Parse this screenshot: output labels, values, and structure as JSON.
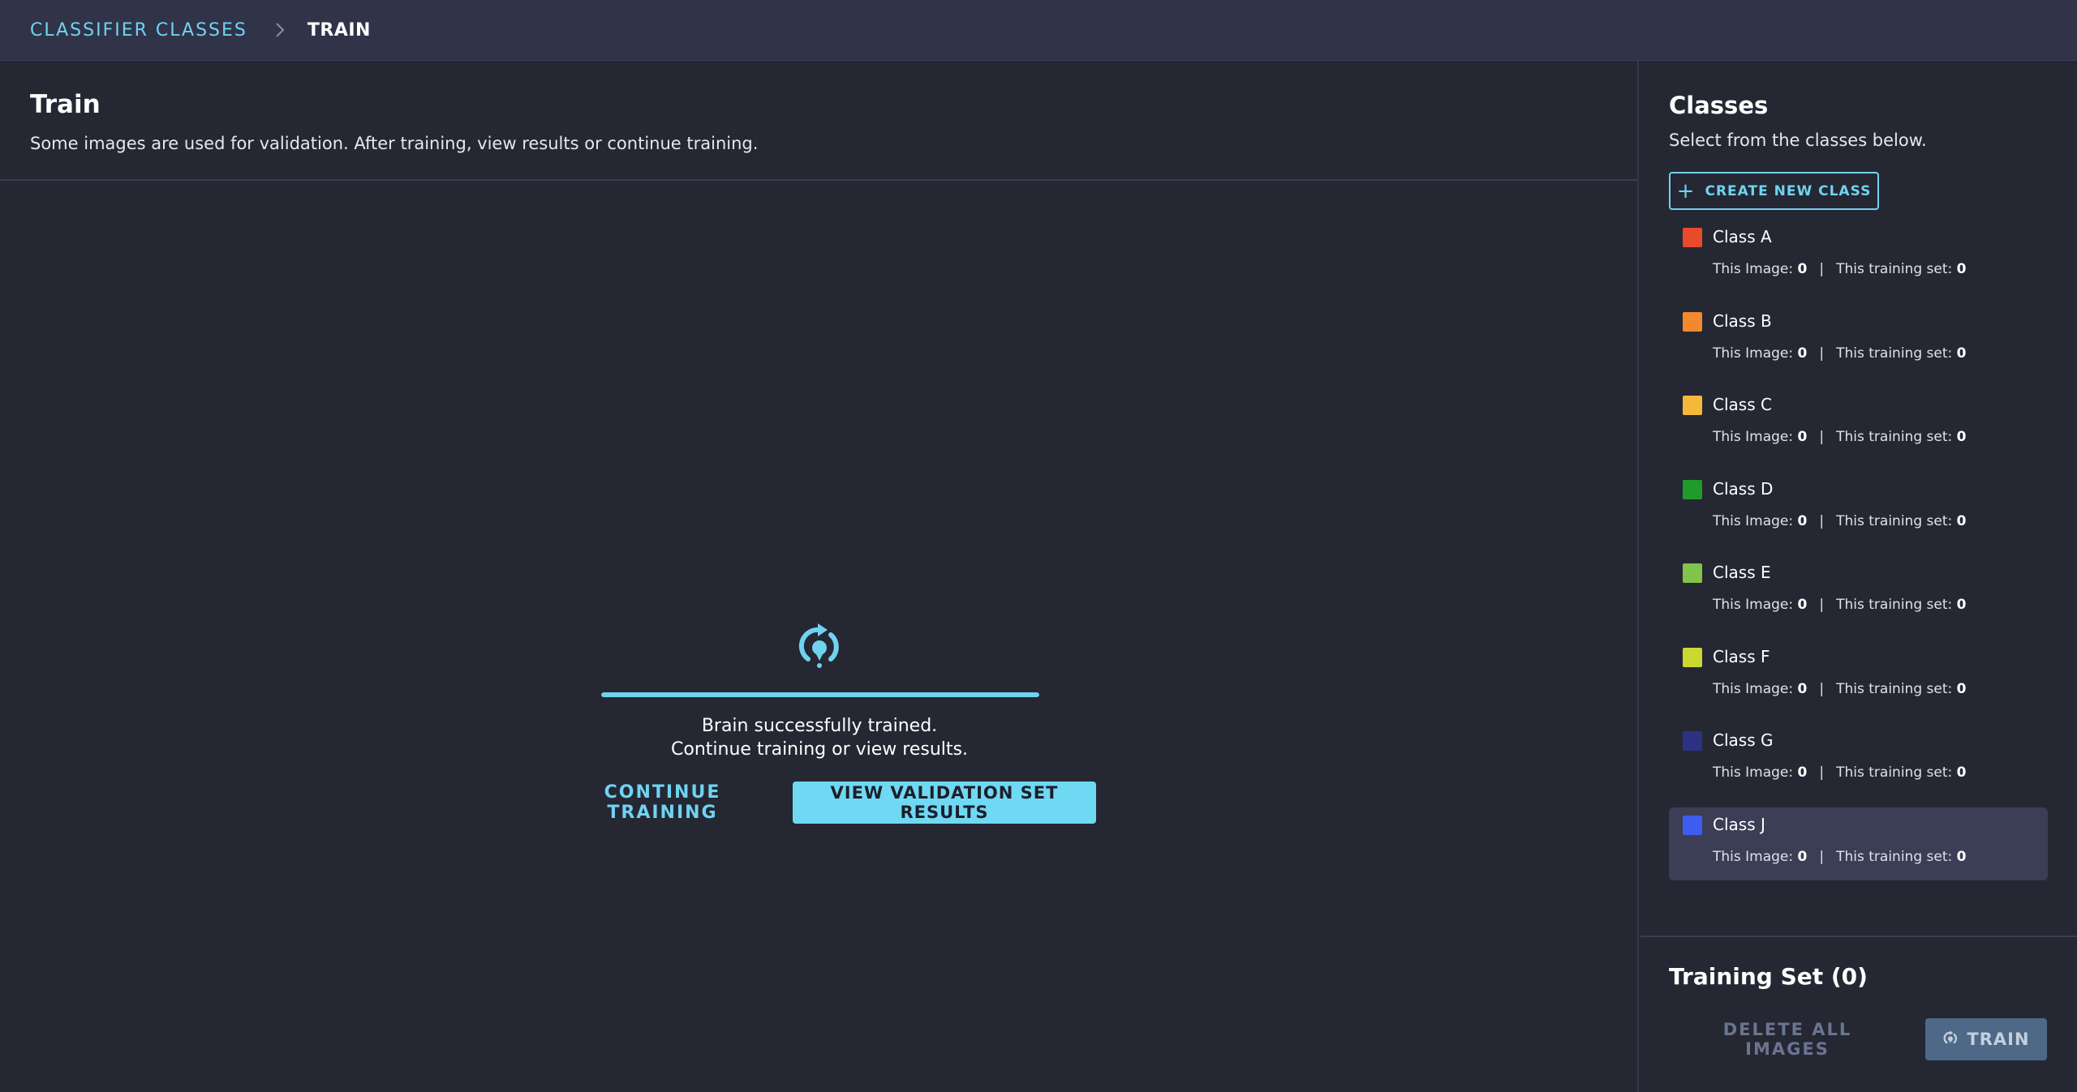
{
  "breadcrumb": {
    "parent": "CLASSIFIER CLASSES",
    "current": "TRAIN"
  },
  "main": {
    "title": "Train",
    "subtitle": "Some images are used for validation. After training, view results or continue training.",
    "progress_percent": 100,
    "status_line1": "Brain successfully trained.",
    "status_line2": "Continue training or view results.",
    "continue_label": "CONTINUE TRAINING",
    "results_label": "VIEW VALIDATION SET RESULTS",
    "icon": "brain-train-icon"
  },
  "sidebar": {
    "title": "Classes",
    "subtitle": "Select from the classes below.",
    "create_label": "CREATE NEW CLASS",
    "stat_image_label": "This Image:",
    "stat_set_label": "This training set:",
    "classes": [
      {
        "name": "Class A",
        "color": "#e94a2c",
        "this_image": "0",
        "this_set": "0",
        "selected": false
      },
      {
        "name": "Class B",
        "color": "#f2892f",
        "this_image": "0",
        "this_set": "0",
        "selected": false
      },
      {
        "name": "Class C",
        "color": "#f5b93a",
        "this_image": "0",
        "this_set": "0",
        "selected": false
      },
      {
        "name": "Class D",
        "color": "#1f9a2b",
        "this_image": "0",
        "this_set": "0",
        "selected": false
      },
      {
        "name": "Class E",
        "color": "#82c34a",
        "this_image": "0",
        "this_set": "0",
        "selected": false
      },
      {
        "name": "Class F",
        "color": "#c9d930",
        "this_image": "0",
        "this_set": "0",
        "selected": false
      },
      {
        "name": "Class G",
        "color": "#2d3184",
        "this_image": "0",
        "this_set": "0",
        "selected": false
      },
      {
        "name": "Class J",
        "color": "#3f5cf0",
        "this_image": "0",
        "this_set": "0",
        "selected": true
      }
    ],
    "training_set_title": "Training Set (0)",
    "delete_label": "DELETE ALL IMAGES",
    "train_label": "TRAIN"
  },
  "colors": {
    "accent": "#6fd3f0",
    "background": "#252733",
    "topbar": "#313449"
  }
}
